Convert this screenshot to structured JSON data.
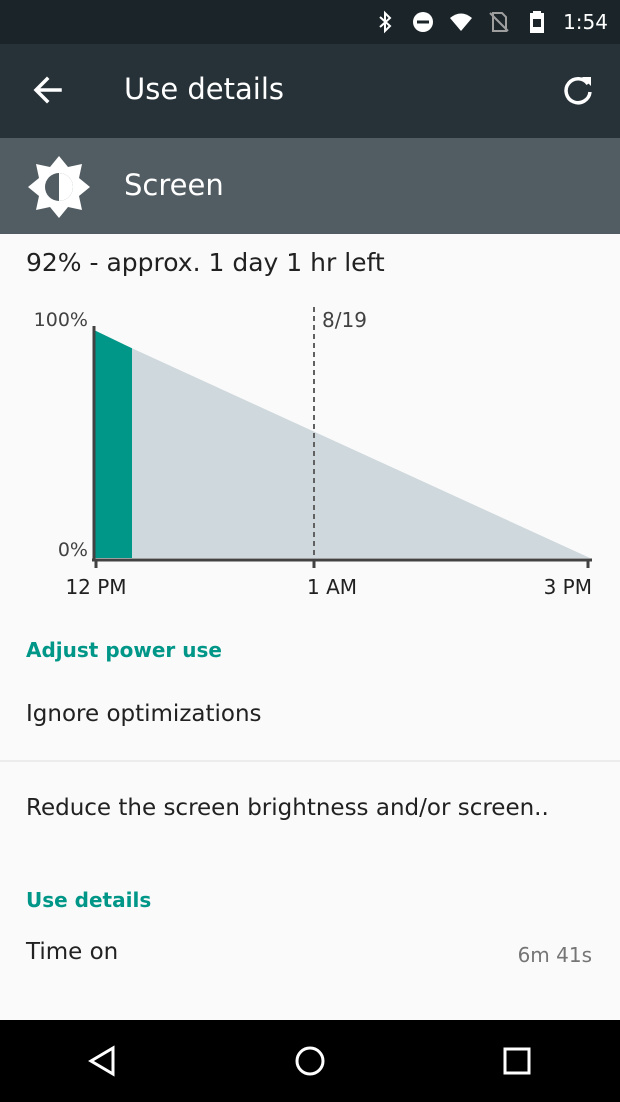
{
  "status_bar": {
    "time": "1:54",
    "icons": [
      "bluetooth-icon",
      "do-not-disturb-icon",
      "wifi-icon",
      "no-sim-icon",
      "battery-icon"
    ]
  },
  "toolbar": {
    "title": "Use details",
    "back_icon": "arrow-back-icon",
    "refresh_icon": "refresh-icon"
  },
  "app": {
    "name": "Screen",
    "icon": "brightness-icon"
  },
  "battery": {
    "summary": "92% - approx. 1 day 1 hr left"
  },
  "chart_data": {
    "type": "area",
    "y_tick_labels": [
      "100%",
      "0%"
    ],
    "x_tick_labels": [
      "12 PM",
      "1 AM",
      "3 PM"
    ],
    "marker_label": "8/19",
    "ylim": [
      0,
      100
    ],
    "used_level": [
      100,
      92
    ],
    "projected_level": [
      92,
      0
    ],
    "colors": {
      "used": "#009688",
      "projected": "#cfd8dc",
      "axis": "#424242"
    }
  },
  "sections": {
    "adjust_power_label": "Adjust power use",
    "ignore_optimizations": "Ignore optimizations",
    "reduce_brightness": "Reduce the screen brightness and/or screen..",
    "use_details_label": "Use details",
    "time_on_label": "Time on",
    "time_on_value": "6m 41s"
  },
  "nav": {
    "back": "nav-back-icon",
    "home": "nav-home-icon",
    "recents": "nav-recents-icon"
  },
  "colors": {
    "accent": "#009688",
    "toolbar": "#263238",
    "header": "#525d63",
    "status_bar": "#1b2529"
  }
}
